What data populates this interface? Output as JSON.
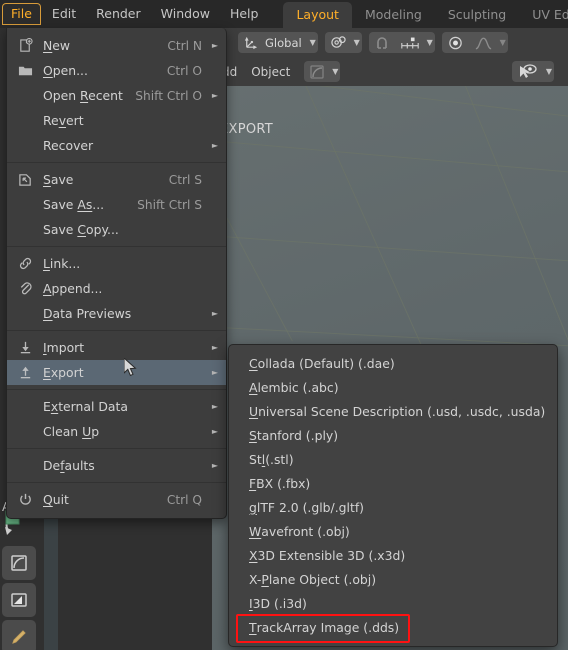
{
  "app": {
    "name": "Blender",
    "accent_color": "#ffaf29",
    "menu_bg": "#3d3d3d",
    "submenu_bg": "#424242",
    "highlight_color": "#5b6874",
    "annotation_color": "#ff1212"
  },
  "topbar": {
    "menus": [
      {
        "label": "File",
        "active": true
      },
      {
        "label": "Edit",
        "active": false
      },
      {
        "label": "Render",
        "active": false
      },
      {
        "label": "Window",
        "active": false
      },
      {
        "label": "Help",
        "active": false
      }
    ],
    "workspace_tabs": [
      {
        "label": "Layout",
        "selected": true
      },
      {
        "label": "Modeling",
        "selected": false
      },
      {
        "label": "Sculpting",
        "selected": false
      },
      {
        "label": "UV Editing",
        "selected": false
      }
    ]
  },
  "header": {
    "orientation_value": "Global",
    "row2_menus": [
      "Add",
      "Object"
    ]
  },
  "viewport": {
    "label": "EXPORT"
  },
  "file_menu": {
    "items": [
      {
        "icon": "new-file-icon",
        "label": "New",
        "underline": "N",
        "shortcut": "Ctrl N",
        "arrow": true,
        "highlight": false
      },
      {
        "icon": "folder-icon",
        "label": "Open...",
        "underline": "O",
        "shortcut": "Ctrl O",
        "arrow": false,
        "highlight": false
      },
      {
        "icon": "",
        "label": "Open Recent",
        "underline": "R",
        "shortcut": "Shift Ctrl O",
        "arrow": true,
        "highlight": false
      },
      {
        "icon": "",
        "label": "Revert",
        "underline": "v",
        "shortcut": "",
        "arrow": false,
        "highlight": false
      },
      {
        "icon": "",
        "label": "Recover",
        "underline": "",
        "shortcut": "",
        "arrow": true,
        "highlight": false
      },
      {
        "separator": true
      },
      {
        "icon": "save-icon",
        "label": "Save",
        "underline": "S",
        "shortcut": "Ctrl S",
        "arrow": false,
        "highlight": false
      },
      {
        "icon": "",
        "label": "Save As...",
        "underline": "As",
        "shortcut": "Shift Ctrl S",
        "arrow": false,
        "highlight": false
      },
      {
        "icon": "",
        "label": "Save Copy...",
        "underline": "C",
        "shortcut": "",
        "arrow": false,
        "highlight": false
      },
      {
        "separator": true
      },
      {
        "icon": "link-icon",
        "label": "Link...",
        "underline": "L",
        "shortcut": "",
        "arrow": false,
        "highlight": false
      },
      {
        "icon": "append-icon",
        "label": "Append...",
        "underline": "A",
        "shortcut": "",
        "arrow": false,
        "highlight": false
      },
      {
        "icon": "",
        "label": "Data Previews",
        "underline": "D",
        "shortcut": "",
        "arrow": true,
        "highlight": false
      },
      {
        "separator": true
      },
      {
        "icon": "import-icon",
        "label": "Import",
        "underline": "I",
        "shortcut": "",
        "arrow": true,
        "highlight": false
      },
      {
        "icon": "export-icon",
        "label": "Export",
        "underline": "E",
        "shortcut": "",
        "arrow": true,
        "highlight": true
      },
      {
        "separator": true
      },
      {
        "icon": "",
        "label": "External Data",
        "underline": "x",
        "shortcut": "",
        "arrow": true,
        "highlight": false
      },
      {
        "icon": "",
        "label": "Clean Up",
        "underline": "U",
        "shortcut": "",
        "arrow": true,
        "highlight": false
      },
      {
        "separator": true
      },
      {
        "icon": "",
        "label": "Defaults",
        "underline": "f",
        "shortcut": "",
        "arrow": true,
        "highlight": false
      },
      {
        "separator": true
      },
      {
        "icon": "power-icon",
        "label": "Quit",
        "underline": "Q",
        "shortcut": "Ctrl Q",
        "arrow": false,
        "highlight": false
      }
    ]
  },
  "export_submenu": {
    "items": [
      {
        "label": "Collada (Default) (.dae)",
        "underline": "C",
        "annotated": false
      },
      {
        "label": "Alembic (.abc)",
        "underline": "A",
        "annotated": false
      },
      {
        "label": "Universal Scene Description (.usd, .usdc, .usda)",
        "underline": "U",
        "annotated": false
      },
      {
        "label": "Stanford (.ply)",
        "underline": "S",
        "annotated": false
      },
      {
        "label": "Stl (.stl)",
        "underline": "l",
        "annotated": false
      },
      {
        "label": "FBX (.fbx)",
        "underline": "F",
        "annotated": false
      },
      {
        "label": "glTF 2.0 (.glb/.gltf)",
        "underline": "g",
        "annotated": false
      },
      {
        "label": "Wavefront (.obj)",
        "underline": "W",
        "annotated": false
      },
      {
        "label": "X3D Extensible 3D (.x3d)",
        "underline": "X",
        "annotated": false
      },
      {
        "label": "X-Plane Object (.obj)",
        "underline": "P",
        "annotated": false
      },
      {
        "label": "I3D (.i3d)",
        "underline": "I",
        "annotated": false
      },
      {
        "label": "TrackArray Image (.dds)",
        "underline": "T",
        "annotated": true
      }
    ]
  }
}
